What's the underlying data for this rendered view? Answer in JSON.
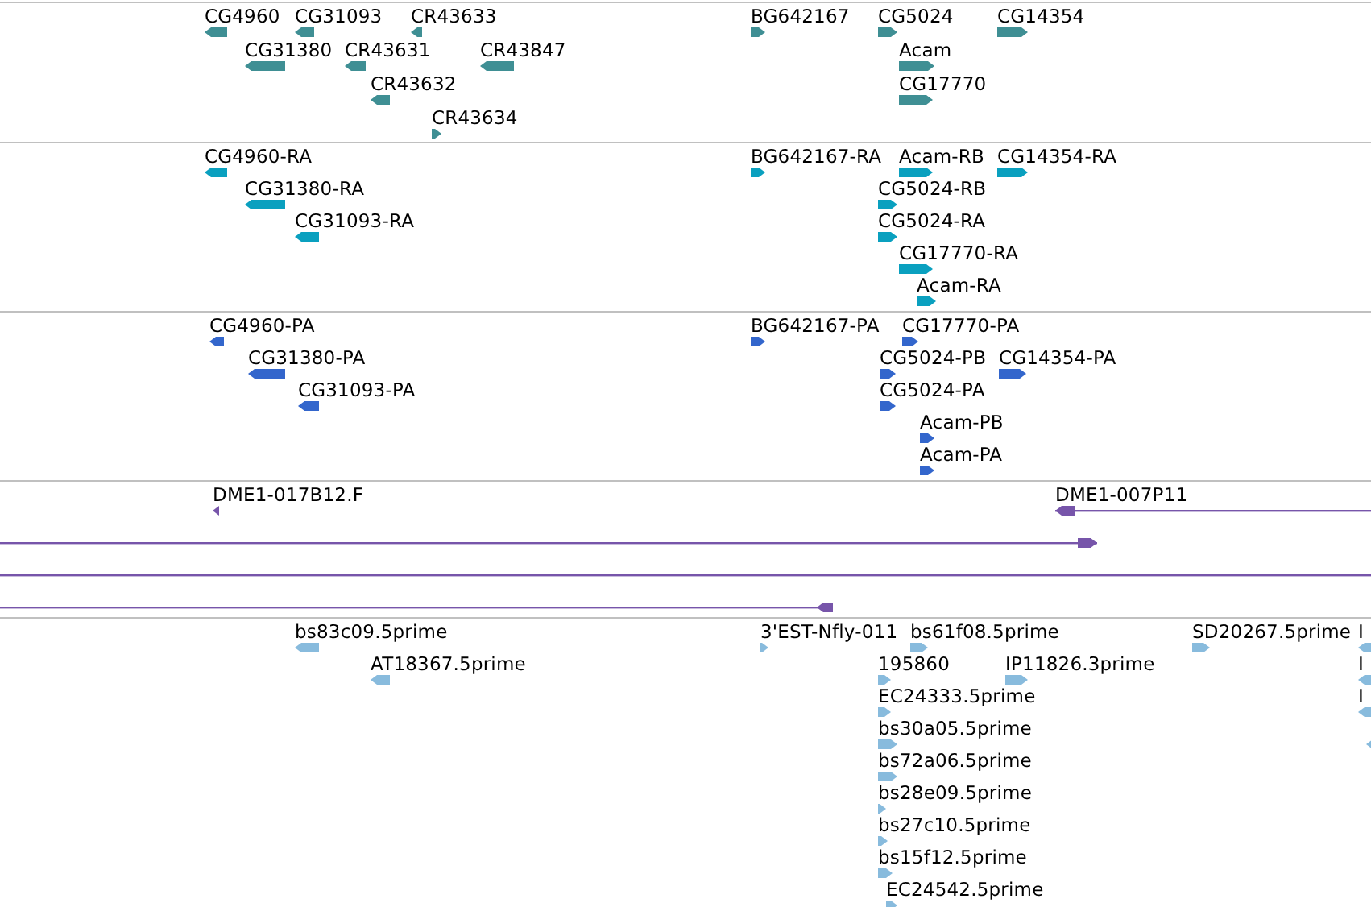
{
  "tracks": [
    {
      "kind": "gene",
      "color": "#3f8f94",
      "features": [
        {
          "label": "CG4960",
          "reverse": true
        },
        {
          "label": "CG31093",
          "reverse": true
        },
        {
          "label": "CR43633",
          "reverse": true
        },
        {
          "label": "CG31380",
          "reverse": true
        },
        {
          "label": "CR43631",
          "reverse": true
        },
        {
          "label": "CR43847",
          "reverse": true
        },
        {
          "label": "CR43632",
          "reverse": true
        },
        {
          "label": "CR43634",
          "reverse": false
        },
        {
          "label": "BG642167",
          "reverse": false
        },
        {
          "label": "CG5024",
          "reverse": false
        },
        {
          "label": "CG14354",
          "reverse": false
        },
        {
          "label": "Acam",
          "reverse": false
        },
        {
          "label": "CG17770",
          "reverse": false
        }
      ]
    },
    {
      "kind": "transcript",
      "color": "#0aa0bf",
      "features": [
        {
          "label": "CG4960-RA",
          "reverse": true
        },
        {
          "label": "CG31380-RA",
          "reverse": true
        },
        {
          "label": "CG31093-RA",
          "reverse": true
        },
        {
          "label": "BG642167-RA",
          "reverse": false
        },
        {
          "label": "Acam-RB",
          "reverse": false
        },
        {
          "label": "CG14354-RA",
          "reverse": false
        },
        {
          "label": "CG5024-RB",
          "reverse": false
        },
        {
          "label": "CG5024-RA",
          "reverse": false
        },
        {
          "label": "CG17770-RA",
          "reverse": false
        },
        {
          "label": "Acam-RA",
          "reverse": false
        }
      ]
    },
    {
      "kind": "protein",
      "color": "#3366cc",
      "features": [
        {
          "label": "CG4960-PA",
          "reverse": true
        },
        {
          "label": "CG31380-PA",
          "reverse": true
        },
        {
          "label": "CG31093-PA",
          "reverse": true
        },
        {
          "label": "BG642167-PA",
          "reverse": false
        },
        {
          "label": "CG17770-PA",
          "reverse": false
        },
        {
          "label": "CG5024-PB",
          "reverse": false
        },
        {
          "label": "CG14354-PA",
          "reverse": false
        },
        {
          "label": "CG5024-PA",
          "reverse": false
        },
        {
          "label": "Acam-PB",
          "reverse": false
        },
        {
          "label": "Acam-PA",
          "reverse": false
        }
      ]
    },
    {
      "kind": "clone",
      "color": "#7755aa",
      "features": [
        {
          "kind": "arrow",
          "label": "DME1-017B12.F",
          "reverse": true
        },
        {
          "kind": "headed_line",
          "label": "DME1-007P11",
          "reverse": true
        },
        {
          "kind": "headed_line",
          "reverse": false
        },
        {
          "kind": "line"
        },
        {
          "kind": "headed_line",
          "reverse": true
        }
      ]
    },
    {
      "kind": "est",
      "color": "#88bbdd",
      "features": [
        {
          "label": "bs83c09.5prime",
          "reverse": true
        },
        {
          "label": "AT18367.5prime",
          "reverse": true
        },
        {
          "label": "3'EST-Nfly-011",
          "reverse": false
        },
        {
          "label": "bs61f08.5prime",
          "reverse": false
        },
        {
          "label": "SD20267.5prime",
          "reverse": false
        },
        {
          "label": "I",
          "reverse": true
        },
        {
          "label": "195860",
          "reverse": false
        },
        {
          "label": "IP11826.3prime",
          "reverse": false
        },
        {
          "label": "I",
          "reverse": true
        },
        {
          "label": "EC24333.5prime",
          "reverse": false
        },
        {
          "label": "I",
          "reverse": true
        },
        {
          "label": "bs30a05.5prime",
          "reverse": false
        },
        {
          "reverse": true
        },
        {
          "label": "bs72a06.5prime",
          "reverse": false
        },
        {
          "label": "bs28e09.5prime",
          "reverse": false
        },
        {
          "label": "bs27c10.5prime",
          "reverse": false
        },
        {
          "label": "bs15f12.5prime",
          "reverse": false
        },
        {
          "label": "EC24542.5prime",
          "reverse": false
        }
      ]
    }
  ]
}
